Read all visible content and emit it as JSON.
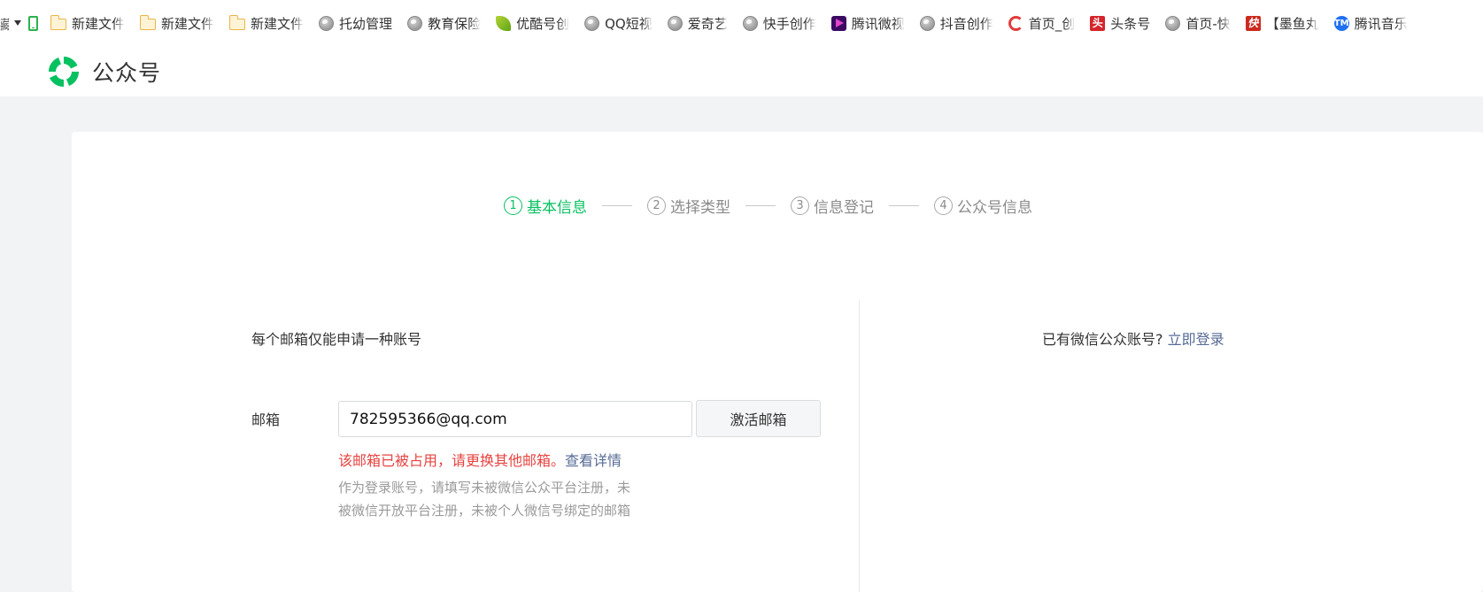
{
  "bookmarks": {
    "edge_text": "藏",
    "items": [
      {
        "icon": "folder-icon",
        "label": "新建文件"
      },
      {
        "icon": "folder-icon",
        "label": "新建文件"
      },
      {
        "icon": "folder-icon",
        "label": "新建文件"
      },
      {
        "icon": "globe-icon",
        "label": "托幼管理"
      },
      {
        "icon": "globe-icon",
        "label": "教育保险"
      },
      {
        "icon": "youku-icon",
        "label": "优酷号创"
      },
      {
        "icon": "globe-icon",
        "label": "QQ短视"
      },
      {
        "icon": "globe-icon",
        "label": "爱奇艺"
      },
      {
        "icon": "globe-icon",
        "label": "快手创作"
      },
      {
        "icon": "tencent-video-icon",
        "label": "腾讯微视"
      },
      {
        "icon": "globe-icon",
        "label": "抖音创作"
      },
      {
        "icon": "c-logo-icon",
        "label": "首页_创"
      },
      {
        "icon": "toutiao-icon",
        "label": "头条号",
        "glyph": "头"
      },
      {
        "icon": "globe-icon",
        "label": "首页-快"
      },
      {
        "icon": "kuai-icon",
        "label": "【墨鱼丸",
        "glyph": "快"
      },
      {
        "icon": "tencent-music-icon",
        "label": "腾讯音乐",
        "glyph": "TM"
      }
    ]
  },
  "header": {
    "title": "公众号",
    "brand_color": "#07c160"
  },
  "steps": [
    {
      "num": "1",
      "label": "基本信息",
      "active": true
    },
    {
      "num": "2",
      "label": "选择类型",
      "active": false
    },
    {
      "num": "3",
      "label": "信息登记",
      "active": false
    },
    {
      "num": "4",
      "label": "公众号信息",
      "active": false
    }
  ],
  "form": {
    "note": "每个邮箱仅能申请一种账号",
    "email_label": "邮箱",
    "email_value": "782595366@qq.com",
    "activate_button": "激活邮箱",
    "error_text": "该邮箱已被占用，请更换其他邮箱。",
    "error_link": "查看详情",
    "hint_line1": "作为登录账号，请填写未被微信公众平台注册，未",
    "hint_line2": "被微信开放平台注册，未被个人微信号绑定的邮箱"
  },
  "side": {
    "prompt": "已有微信公众账号?",
    "login_link": "立即登录"
  },
  "colors": {
    "error": "#e64340",
    "link": "#576b95",
    "active_step": "#07c160"
  }
}
